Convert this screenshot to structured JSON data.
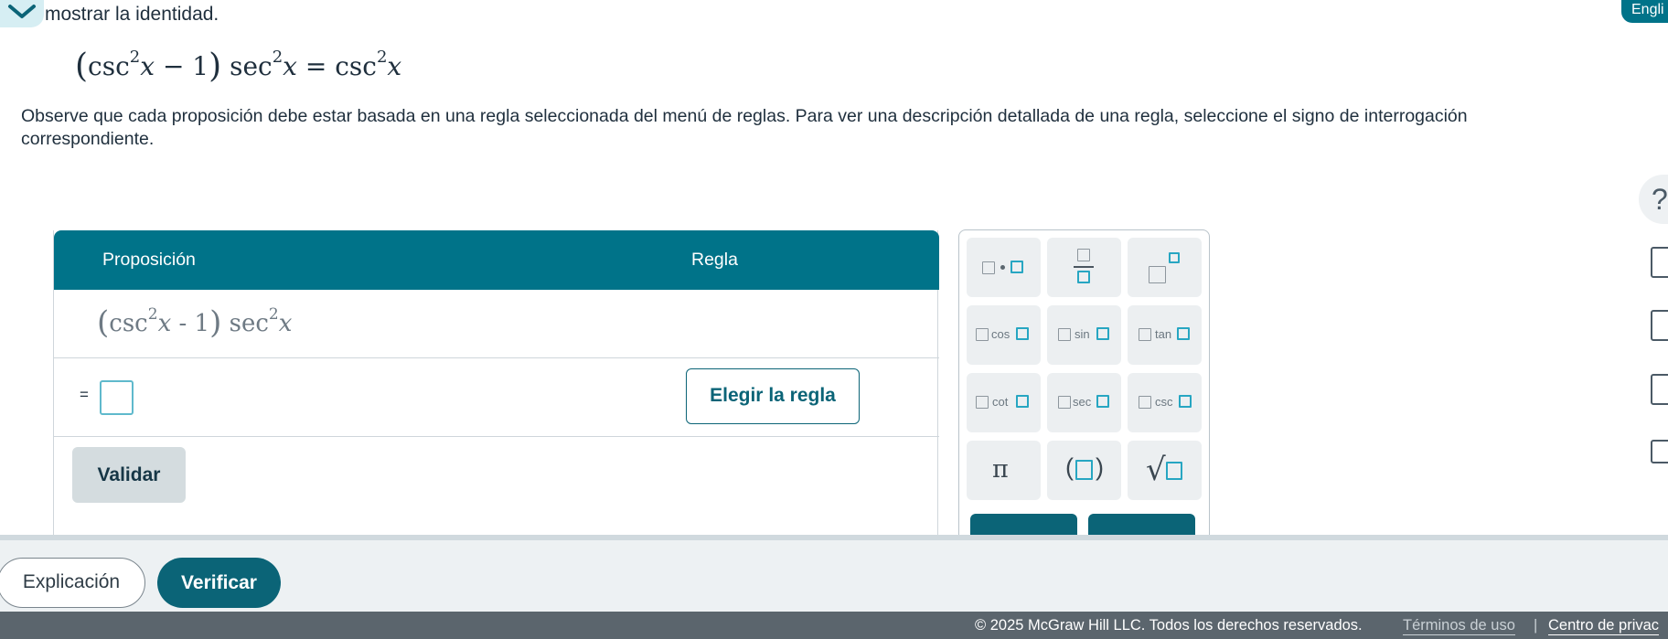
{
  "header": {
    "instruction": "mostrar la identidad.",
    "language_label": "Engli"
  },
  "identity": {
    "lhs_fn1": "csc",
    "lhs_exp1": "2",
    "var": "x",
    "minus_one": "− 1",
    "lhs_fn2": "sec",
    "lhs_exp2": "2",
    "equals": "=",
    "rhs_fn": "csc",
    "rhs_exp": "2"
  },
  "notice": "Observe que cada proposición debe estar basada en una regla seleccionada del menú de reglas. Para ver una descripción detallada de una regla, seleccione el signo de interrogación correspondiente.",
  "table": {
    "col_proposition": "Proposición",
    "col_rule": "Regla",
    "row1": {
      "fn1": "csc",
      "exp1": "2",
      "var": "x",
      "minus_one": "- 1",
      "fn2": "sec",
      "exp2": "2"
    },
    "row2": {
      "equals": "=",
      "choose_rule_label": "Elegir la regla"
    },
    "validate_label": "Validar"
  },
  "keypad": {
    "cos": "cos",
    "sin": "sin",
    "tan": "tan",
    "cot": "cot",
    "sec": "sec",
    "csc": "csc",
    "pi": "π",
    "sqrt": "√"
  },
  "rail": {
    "help_glyph": "?"
  },
  "actions": {
    "explanation_label": "Explicación",
    "verify_label": "Verificar"
  },
  "footer": {
    "copyright": "© 2025 McGraw Hill LLC. Todos los derechos reservados.",
    "terms": "Términos de uso",
    "separator": "|",
    "privacy": "Centro de privac"
  },
  "colors": {
    "brand_teal": "#007389",
    "button_teal": "#0b6477",
    "input_border": "#5fb9cc"
  }
}
